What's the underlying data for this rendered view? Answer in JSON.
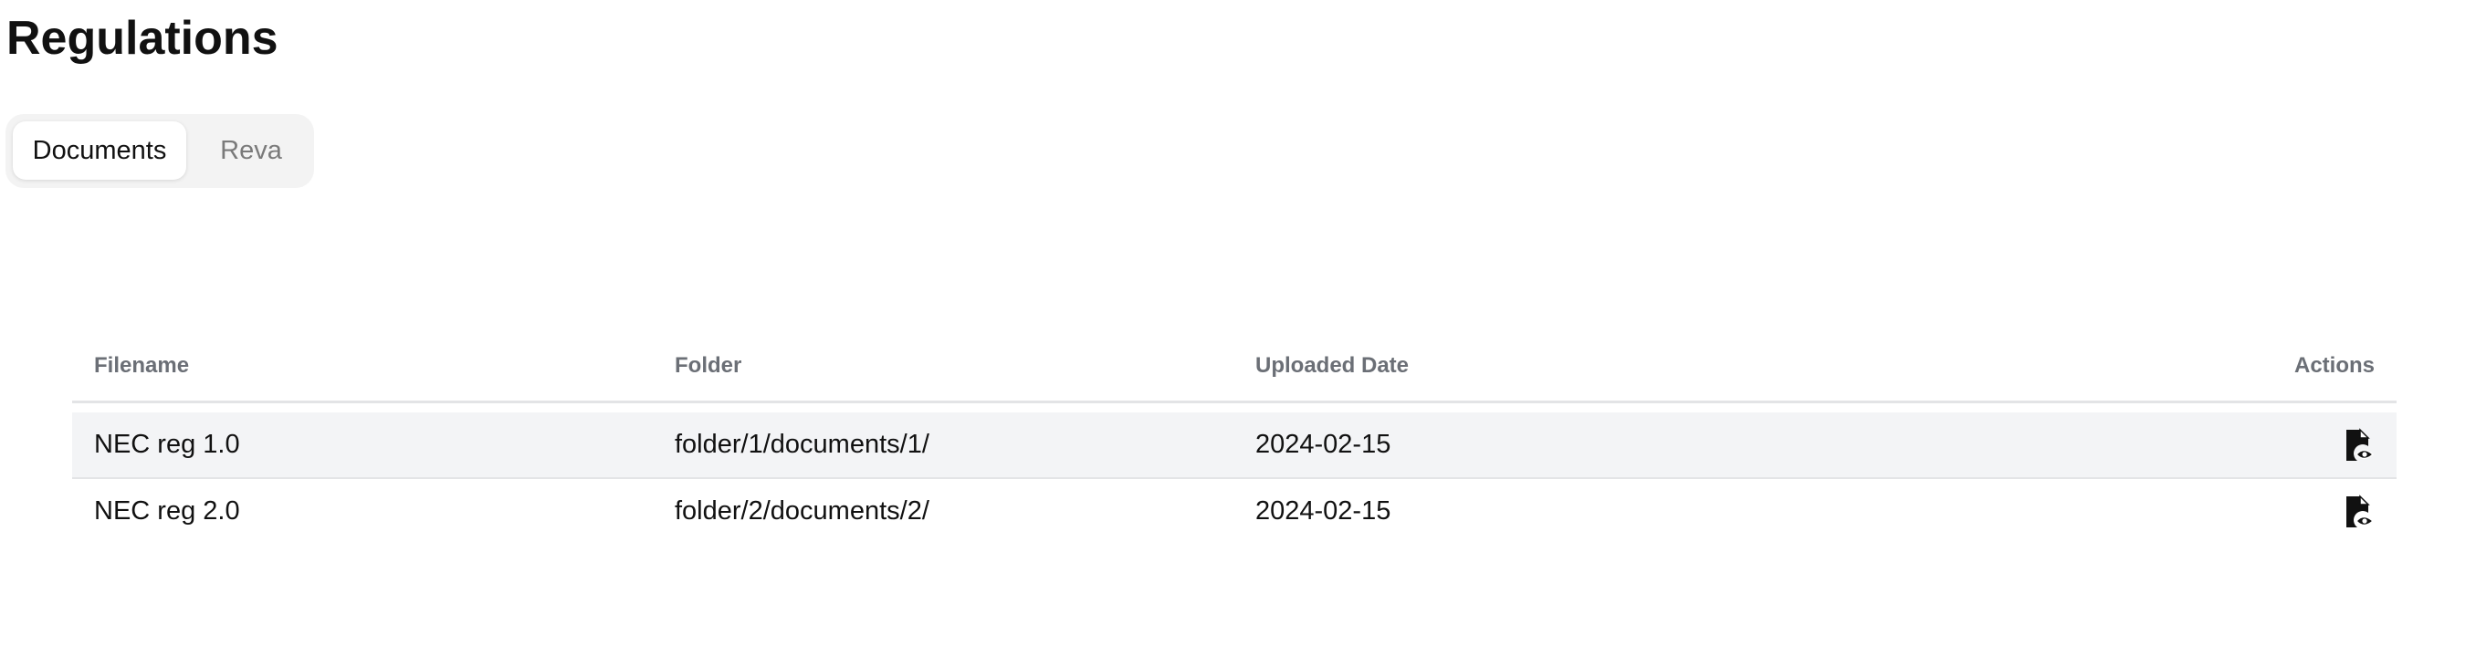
{
  "page": {
    "title": "Regulations"
  },
  "tabs": [
    {
      "label": "Documents",
      "active": true
    },
    {
      "label": "Reva",
      "active": false
    }
  ],
  "table": {
    "columns": {
      "filename": "Filename",
      "folder": "Folder",
      "uploaded_date": "Uploaded Date",
      "actions": "Actions"
    },
    "rows": [
      {
        "filename": "NEC reg 1.0",
        "folder": "folder/1/documents/1/",
        "uploaded_date": "2024-02-15",
        "action_icon": "view-document-icon",
        "hovered": true
      },
      {
        "filename": "NEC reg 2.0",
        "folder": "folder/2/documents/2/",
        "uploaded_date": "2024-02-15",
        "action_icon": "view-document-icon",
        "hovered": false
      }
    ]
  },
  "colors": {
    "text": "#111111",
    "header_text": "#6b6f76",
    "tab_bar_bg": "#f3f3f3",
    "row_highlight": "#f3f4f6",
    "divider": "#e3e4e6",
    "inactive_tab_text": "#7a7a7a"
  }
}
